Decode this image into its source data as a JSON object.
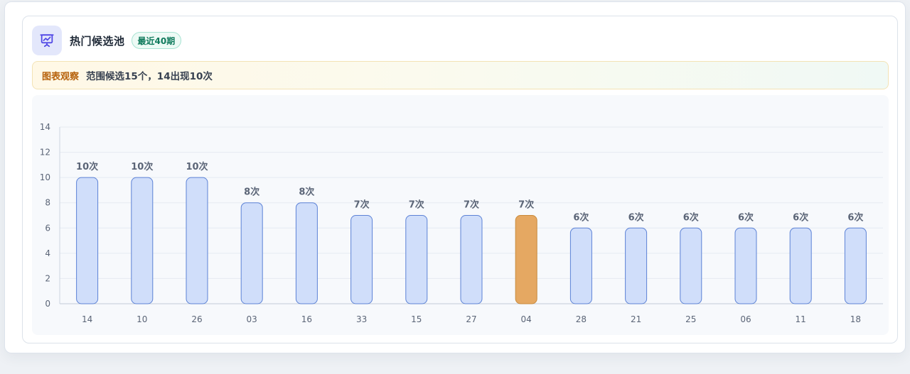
{
  "header": {
    "title": "热门候选池",
    "badge": "最近40期",
    "icon": "chart-presentation-icon"
  },
  "notice": {
    "tag": "图表观察",
    "text": "范围候选15个，14出现10次"
  },
  "colors": {
    "bar_fill": "#d0defa",
    "bar_stroke": "#5c82d6",
    "highlight_fill": "#e5a862",
    "highlight_stroke": "#c98a3c",
    "label": "#5b6577"
  },
  "chart_data": {
    "type": "bar",
    "categories": [
      "14",
      "10",
      "26",
      "03",
      "16",
      "33",
      "15",
      "27",
      "04",
      "28",
      "21",
      "25",
      "06",
      "11",
      "18"
    ],
    "values": [
      10,
      10,
      10,
      8,
      8,
      7,
      7,
      7,
      7,
      6,
      6,
      6,
      6,
      6,
      6
    ],
    "data_labels": [
      "10次",
      "10次",
      "10次",
      "8次",
      "8次",
      "7次",
      "7次",
      "7次",
      "7次",
      "6次",
      "6次",
      "6次",
      "6次",
      "6次",
      "6次"
    ],
    "highlight_index": 8,
    "ylim": [
      0,
      14
    ],
    "yticks": [
      0,
      2,
      4,
      6,
      8,
      10,
      12,
      14
    ],
    "grid": true,
    "legend": "none"
  }
}
